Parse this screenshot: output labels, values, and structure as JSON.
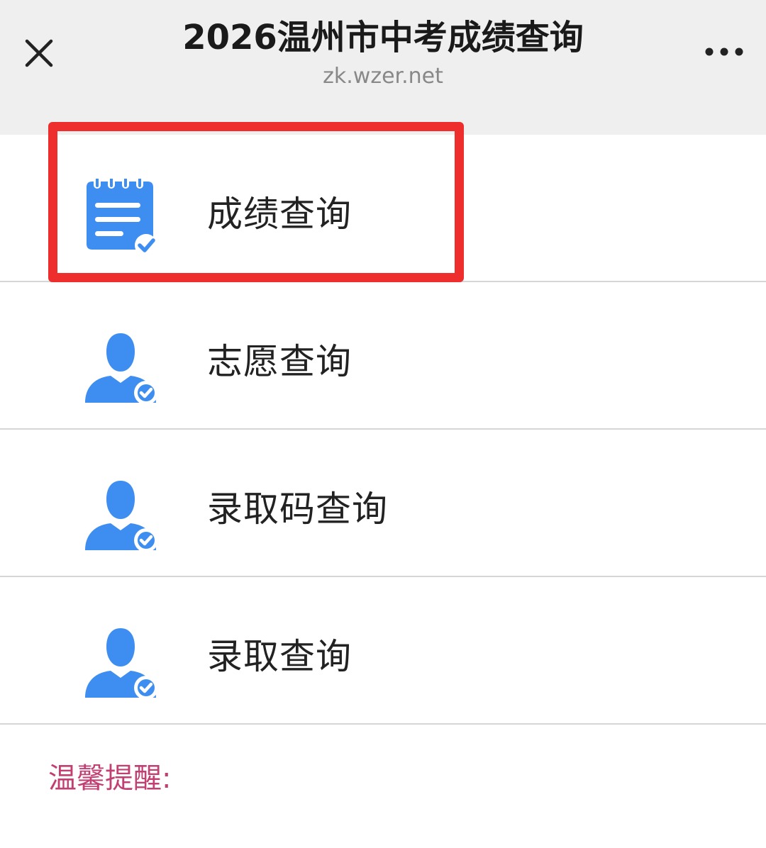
{
  "header": {
    "title": "2026温州市中考成绩查询",
    "url": "zk.wzer.net",
    "close_icon": "close-icon",
    "more_icon": "more-horizontal-icon"
  },
  "menu": {
    "items": [
      {
        "label": "成绩查询",
        "icon": "notepad-check-icon",
        "highlighted": true
      },
      {
        "label": "志愿查询",
        "icon": "user-check-icon",
        "highlighted": false
      },
      {
        "label": "录取码查询",
        "icon": "user-check-icon",
        "highlighted": false
      },
      {
        "label": "录取查询",
        "icon": "user-check-icon",
        "highlighted": false
      }
    ]
  },
  "tip": {
    "label": "温馨提醒:"
  },
  "colors": {
    "icon_blue": "#3d8ef0",
    "highlight_red": "#ee2d2d",
    "tip_pink": "#c23f72",
    "header_bg": "#efefef"
  }
}
